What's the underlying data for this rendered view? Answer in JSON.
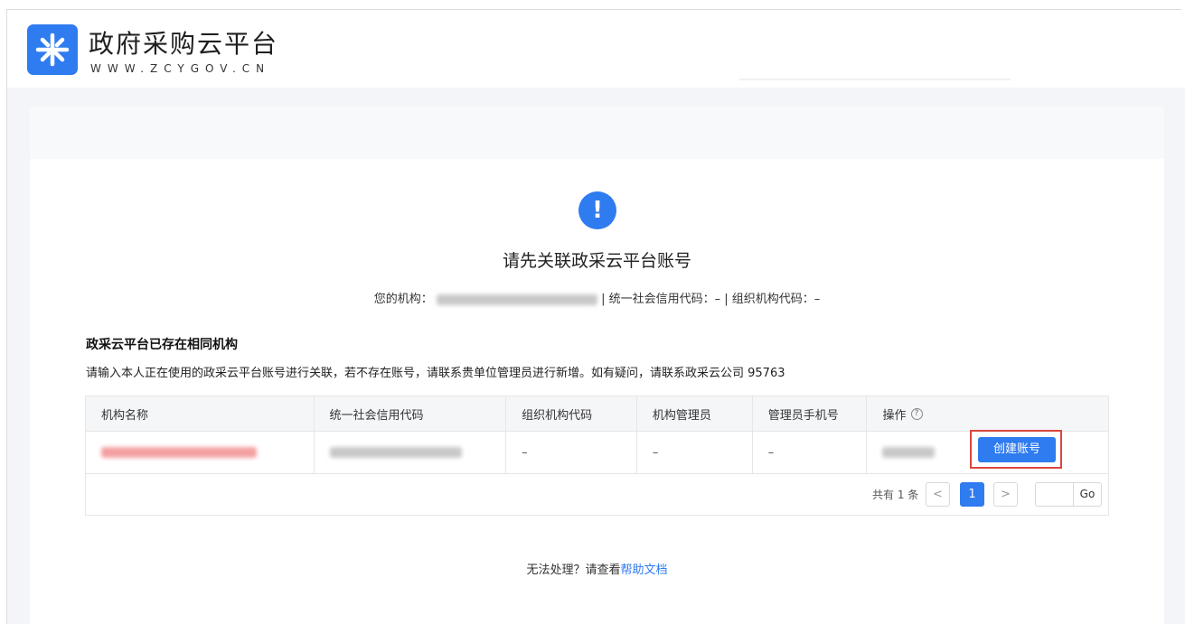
{
  "brand": {
    "title": "政府采购云平台",
    "subtitle": "WWW.ZCYGOV.CN",
    "brand_color": "#2f7bf0"
  },
  "notice": {
    "icon": "exclamation-icon",
    "title": "请先关联政采云平台账号",
    "org_label": "您的机构：",
    "credit_code_label": "| 统一社会信用代码：– | 组织机构代码：–"
  },
  "section": {
    "title": "政采云平台已存在相同机构",
    "description": "请输入本人正在使用的政采云平台账号进行关联，若不存在账号，请联系贵单位管理员进行新增。如有疑问，请联系政采云公司 95763"
  },
  "table": {
    "columns": [
      "机构名称",
      "统一社会信用代码",
      "组织机构代码",
      "机构管理员",
      "管理员手机号",
      "操作"
    ],
    "rows": [
      {
        "org_code": "–",
        "admin": "–",
        "admin_phone": "–",
        "action": "创建账号"
      }
    ]
  },
  "pagination": {
    "total": "共有 1 条",
    "prev": "<",
    "current_page": "1",
    "next": ">",
    "go": "Go"
  },
  "footer": {
    "prefix": "无法处理？请查看",
    "link": "帮助文档"
  }
}
